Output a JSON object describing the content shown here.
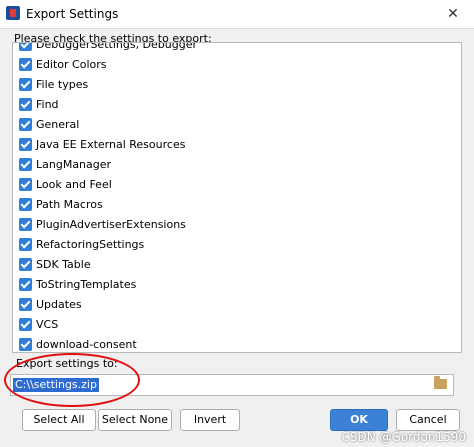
{
  "window": {
    "title": "Export Settings",
    "close_glyph": "✕"
  },
  "instruction": "Please check the settings to export:",
  "settings": [
    {
      "label": "DebuggerSettings, Debugger",
      "checked": true
    },
    {
      "label": "Editor Colors",
      "checked": true
    },
    {
      "label": "File types",
      "checked": true
    },
    {
      "label": "Find",
      "checked": true
    },
    {
      "label": "General",
      "checked": true
    },
    {
      "label": "Java EE External Resources",
      "checked": true
    },
    {
      "label": "LangManager",
      "checked": true
    },
    {
      "label": "Look and Feel",
      "checked": true
    },
    {
      "label": "Path Macros",
      "checked": true
    },
    {
      "label": "PluginAdvertiserExtensions",
      "checked": true
    },
    {
      "label": "RefactoringSettings",
      "checked": true
    },
    {
      "label": "SDK Table",
      "checked": true
    },
    {
      "label": "ToStringTemplates",
      "checked": true
    },
    {
      "label": "Updates",
      "checked": true
    },
    {
      "label": "VCS",
      "checked": true
    },
    {
      "label": "download-consent",
      "checked": true
    }
  ],
  "export": {
    "label": "Export settings to:",
    "path": "C:\\\\settings.zip"
  },
  "buttons": {
    "select_all": "Select All",
    "select_none": "Select None",
    "invert": "Invert",
    "ok": "OK",
    "cancel": "Cancel"
  },
  "watermark": "CSDN @Gordon1590",
  "colors": {
    "checkbox": "#2f7ed8",
    "ok_button": "#3b82d6",
    "annotation": "#e01010"
  }
}
